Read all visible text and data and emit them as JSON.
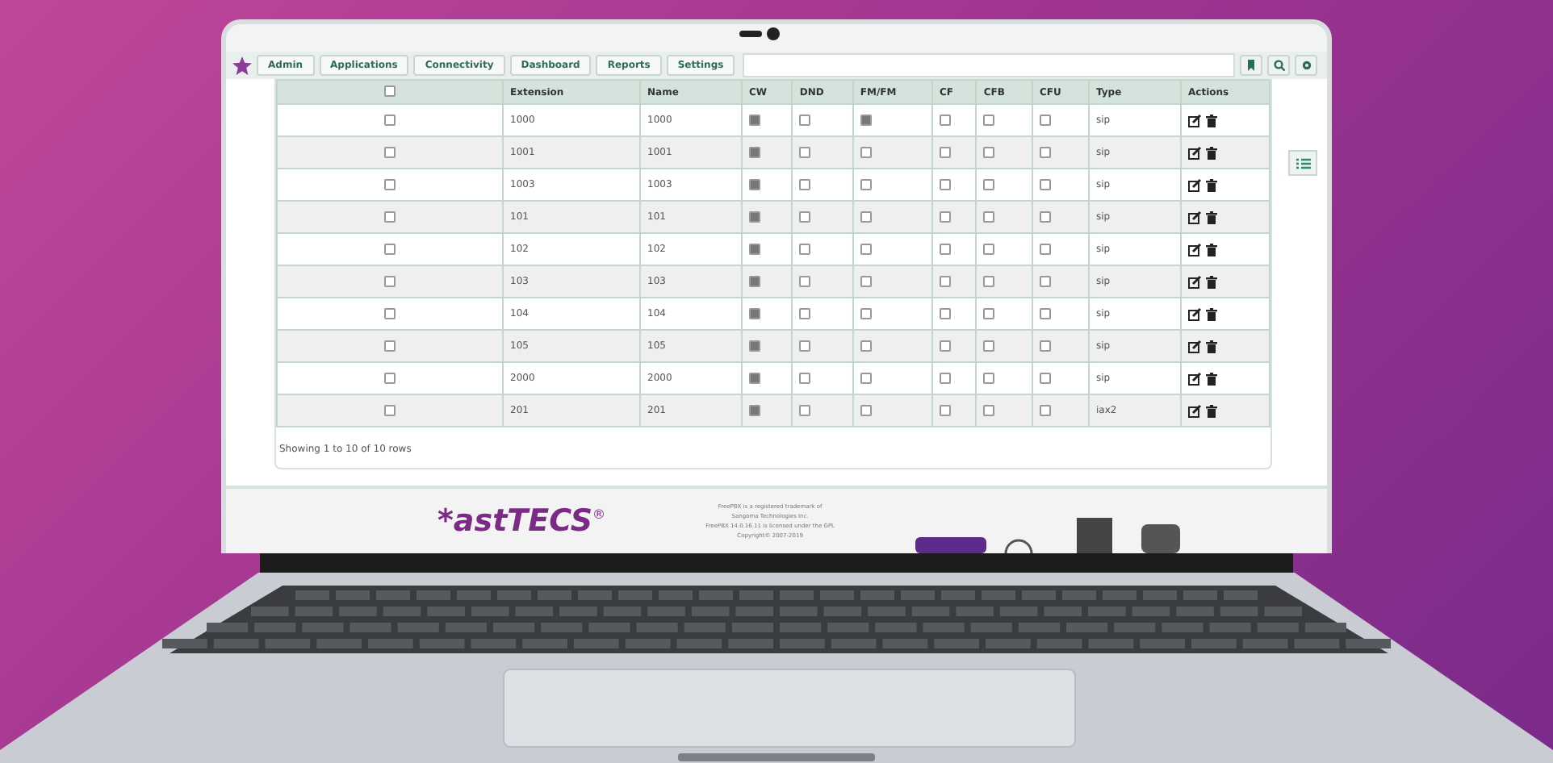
{
  "nav": {
    "tabs": [
      {
        "label": "Admin",
        "selected": false
      },
      {
        "label": "Applications",
        "selected": false
      },
      {
        "label": "Connectivity",
        "selected": false
      },
      {
        "label": "Dashboard",
        "selected": false
      },
      {
        "label": "Reports",
        "selected": false
      },
      {
        "label": "Settings",
        "selected": false
      }
    ]
  },
  "table": {
    "columns": [
      "Extension",
      "Name",
      "CW",
      "DND",
      "FM/FM",
      "CF",
      "CFB",
      "CFU",
      "Type",
      "Actions"
    ],
    "header_checked": false,
    "rows": [
      {
        "selected": false,
        "extension": "1000",
        "name": "1000",
        "cw": true,
        "dnd": false,
        "fmfm": true,
        "cf": false,
        "cfb": false,
        "cfu": false,
        "type": "sip"
      },
      {
        "selected": false,
        "extension": "1001",
        "name": "1001",
        "cw": true,
        "dnd": false,
        "fmfm": false,
        "cf": false,
        "cfb": false,
        "cfu": false,
        "type": "sip"
      },
      {
        "selected": false,
        "extension": "1003",
        "name": "1003",
        "cw": true,
        "dnd": false,
        "fmfm": false,
        "cf": false,
        "cfb": false,
        "cfu": false,
        "type": "sip"
      },
      {
        "selected": false,
        "extension": "101",
        "name": "101",
        "cw": true,
        "dnd": false,
        "fmfm": false,
        "cf": false,
        "cfb": false,
        "cfu": false,
        "type": "sip"
      },
      {
        "selected": false,
        "extension": "102",
        "name": "102",
        "cw": true,
        "dnd": false,
        "fmfm": false,
        "cf": false,
        "cfb": false,
        "cfu": false,
        "type": "sip"
      },
      {
        "selected": false,
        "extension": "103",
        "name": "103",
        "cw": true,
        "dnd": false,
        "fmfm": false,
        "cf": false,
        "cfb": false,
        "cfu": false,
        "type": "sip"
      },
      {
        "selected": false,
        "extension": "104",
        "name": "104",
        "cw": true,
        "dnd": false,
        "fmfm": false,
        "cf": false,
        "cfb": false,
        "cfu": false,
        "type": "sip"
      },
      {
        "selected": false,
        "extension": "105",
        "name": "105",
        "cw": true,
        "dnd": false,
        "fmfm": false,
        "cf": false,
        "cfb": false,
        "cfu": false,
        "type": "sip"
      },
      {
        "selected": false,
        "extension": "2000",
        "name": "2000",
        "cw": true,
        "dnd": false,
        "fmfm": false,
        "cf": false,
        "cfb": false,
        "cfu": false,
        "type": "sip"
      },
      {
        "selected": false,
        "extension": "201",
        "name": "201",
        "cw": true,
        "dnd": false,
        "fmfm": false,
        "cf": false,
        "cfb": false,
        "cfu": false,
        "type": "iax2"
      }
    ],
    "summary": "Showing 1 to 10 of 10 rows"
  },
  "footer": {
    "logo": "*astTECS",
    "logo_mark": "®",
    "legal": [
      "FreePBX is a registered trademark of",
      "Sangoma Technologies Inc.",
      "FreePBX 14.0.16.11 is licensed under the GPL",
      "Copyright© 2007-2019"
    ]
  }
}
